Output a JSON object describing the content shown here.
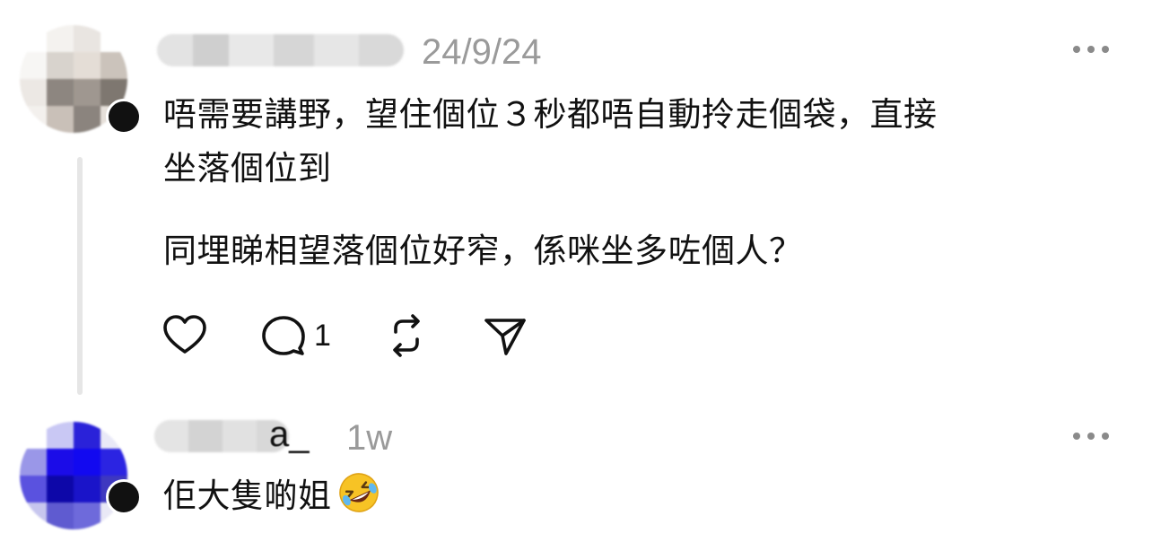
{
  "comments": [
    {
      "timestamp": "24/9/24",
      "paragraphs": [
        "唔需要講野，望住個位３秒都唔自動拎走個袋，直接",
        "坐落個位到",
        "同埋睇相望落個位好窄，係咪坐多咗個人？"
      ],
      "actions": {
        "like_icon": "heart-icon",
        "reply_icon": "comment-icon",
        "reply_count": "1",
        "repost_icon": "repost-icon",
        "share_icon": "send-icon"
      }
    },
    {
      "username_visible_suffix": "a_",
      "timestamp": "1w",
      "text": "佢大隻啲姐",
      "emoji": "rolling-on-floor-laughing-emoji"
    }
  ],
  "colors": {
    "text": "#111111",
    "muted": "#9a9a9a",
    "thread_line": "#e6e6e6"
  }
}
